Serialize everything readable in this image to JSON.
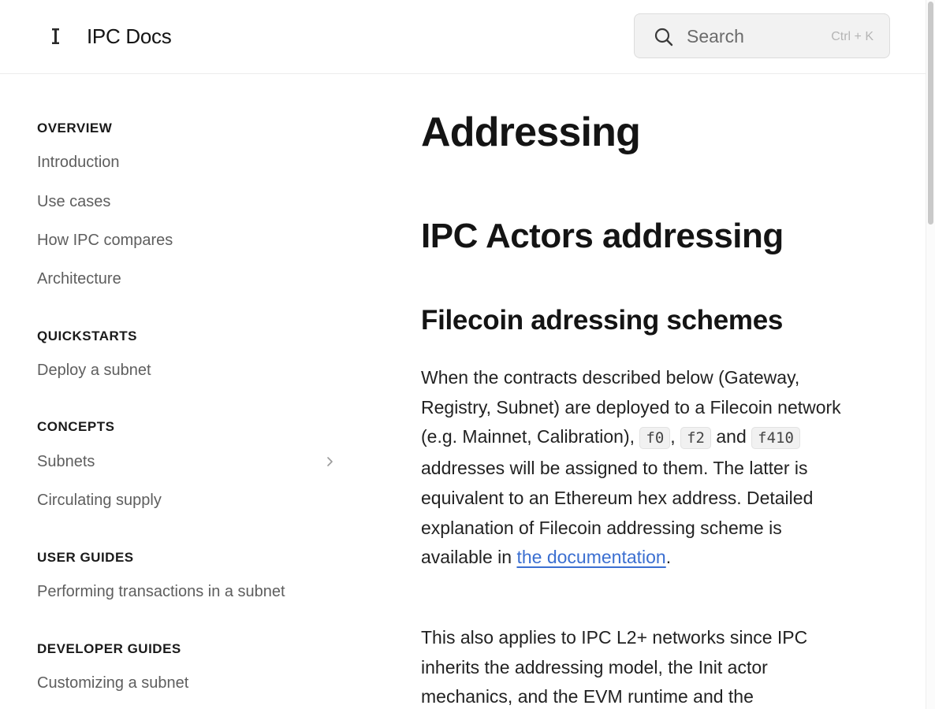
{
  "header": {
    "site_title": "IPC Docs",
    "search_label": "Search",
    "search_shortcut": "Ctrl + K"
  },
  "sidebar": {
    "sections": [
      {
        "heading": "OVERVIEW",
        "items": [
          "Introduction",
          "Use cases",
          "How IPC compares",
          "Architecture"
        ]
      },
      {
        "heading": "QUICKSTARTS",
        "items": [
          "Deploy a subnet"
        ]
      },
      {
        "heading": "CONCEPTS",
        "items": [
          "Subnets",
          "Circulating supply"
        ]
      },
      {
        "heading": "USER GUIDES",
        "items": [
          "Performing transactions in a subnet"
        ]
      },
      {
        "heading": "DEVELOPER GUIDES",
        "items": [
          "Customizing a subnet"
        ]
      }
    ]
  },
  "article": {
    "title": "Addressing",
    "h2": "IPC Actors addressing",
    "h3": "Filecoin adressing schemes",
    "p1": {
      "t1": "When the contracts described below (Gateway, Registry, Subnet) are deployed to a Filecoin network (e.g. Mainnet, Calibration), ",
      "code1": "f0",
      "t2": ", ",
      "code2": "f2",
      "t3": " and ",
      "code3": "f410",
      "t4": " addresses will be assigned to them. The latter is equivalent to an Ethereum hex address. Detailed explanation of Filecoin addressing scheme is available in ",
      "link": "the documentation",
      "t5": "."
    },
    "p2": "This also applies to IPC L2+ networks since IPC inherits the addressing model, the Init actor mechanics, and the EVM runtime and the"
  },
  "colors": {
    "link": "#3b6fd1",
    "heading": "#141414",
    "nav_text": "#5e5e5e"
  },
  "icons": [
    "logo-icon",
    "search-icon",
    "chevron-right-icon"
  ]
}
